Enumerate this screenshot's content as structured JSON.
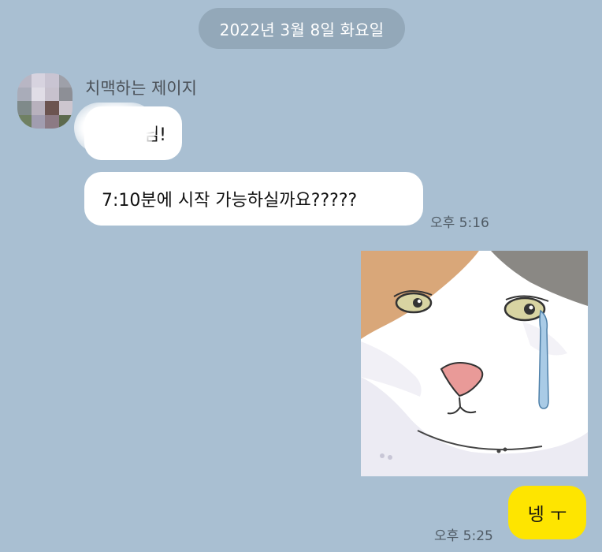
{
  "chat": {
    "date_divider": "2022년 3월 8일 화요일",
    "sender_name": "치맥하는 제이지",
    "messages_in": [
      {
        "text": "님!"
      },
      {
        "text": "7:10분에 시작 가능하실까요?????"
      }
    ],
    "time_in": "오후 5:16",
    "sticker": {
      "description_icon": "crying-cat-sticker"
    },
    "message_out": "넹 ㅜ",
    "time_out": "오후 5:25"
  },
  "colors": {
    "background": "#a9bfd2",
    "my_bubble": "#fee500",
    "their_bubble": "#ffffff",
    "date_pill": "#93a8b9"
  }
}
